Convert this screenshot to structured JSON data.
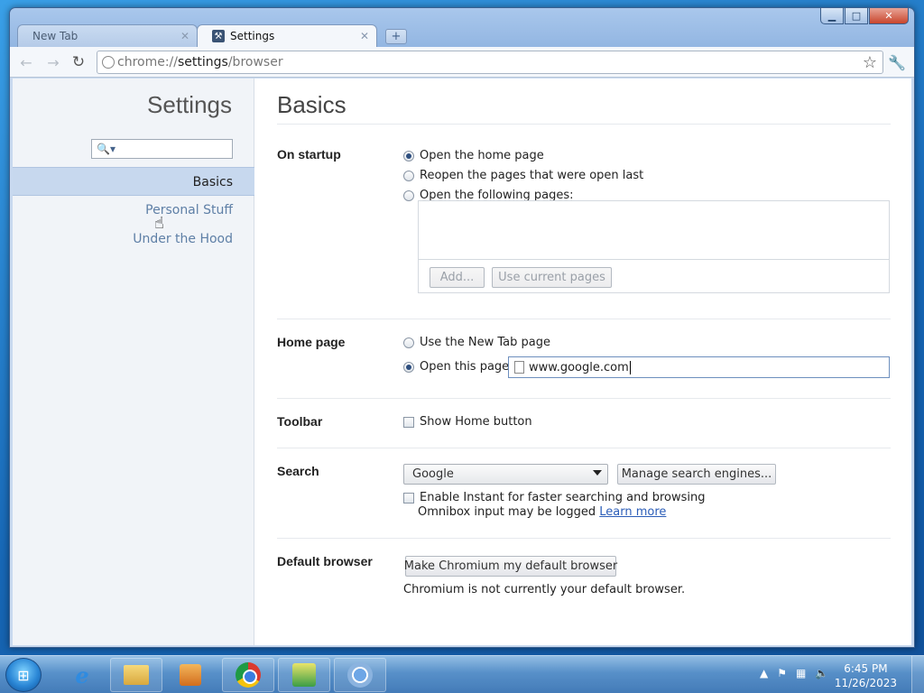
{
  "window": {
    "minimize": "▁",
    "maximize": "□",
    "close": "✕"
  },
  "tabs": [
    {
      "label": "New Tab",
      "active": false
    },
    {
      "label": "Settings",
      "active": true
    }
  ],
  "toolbar": {
    "url_scheme": "chrome://",
    "url_host": "settings",
    "url_path": "/browser"
  },
  "sidebar": {
    "title": "Settings",
    "search_placeholder": "",
    "items": [
      {
        "label": "Basics",
        "selected": true
      },
      {
        "label": "Personal Stuff",
        "selected": false
      },
      {
        "label": "Under the Hood",
        "selected": false
      }
    ]
  },
  "main": {
    "title": "Basics",
    "startup": {
      "label": "On startup",
      "options": [
        "Open the home page",
        "Reopen the pages that were open last",
        "Open the following pages:"
      ],
      "selected": 0,
      "add_button": "Add...",
      "use_current_button": "Use current pages"
    },
    "homepage": {
      "label": "Home page",
      "option_newtab": "Use the New Tab page",
      "option_open": "Open this page:",
      "url_value": "www.google.com"
    },
    "toolbar_section": {
      "label": "Toolbar",
      "show_home": "Show Home button"
    },
    "search": {
      "label": "Search",
      "engine": "Google",
      "manage_button": "Manage search engines...",
      "instant_label": "Enable Instant for faster searching and browsing",
      "omnibox_note": "Omnibox input may be logged",
      "learn_more": "Learn more"
    },
    "default_browser": {
      "label": "Default browser",
      "button": "Make Chromium my default browser",
      "status": "Chromium is not currently your default browser."
    }
  },
  "taskbar": {
    "clock_time": "6:45 PM",
    "clock_date": "11/26/2023"
  },
  "colors": {
    "accent": "#2b5db8",
    "sidebar_selected": "#c7d8ee"
  }
}
